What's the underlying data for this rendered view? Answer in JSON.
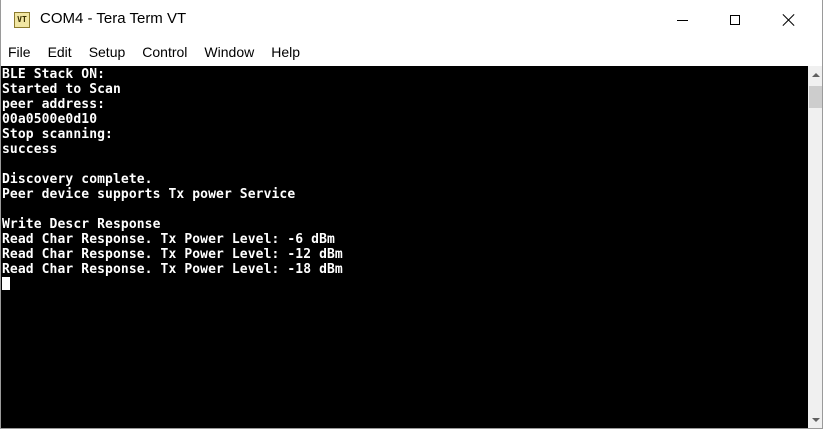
{
  "window": {
    "title": "COM4 - Tera Term VT",
    "icon_text": "VT"
  },
  "menu": {
    "items": [
      "File",
      "Edit",
      "Setup",
      "Control",
      "Window",
      "Help"
    ]
  },
  "terminal": {
    "lines": [
      "BLE Stack ON:",
      "Started to Scan",
      "peer address:",
      "00a0500e0d10",
      "Stop scanning:",
      "success",
      "",
      "Discovery complete.",
      "Peer device supports Tx power Service",
      "",
      "Write Descr Response",
      "Read Char Response. Tx Power Level: -6 dBm",
      "Read Char Response. Tx Power Level: -12 dBm",
      "Read Char Response. Tx Power Level: -18 dBm"
    ]
  }
}
